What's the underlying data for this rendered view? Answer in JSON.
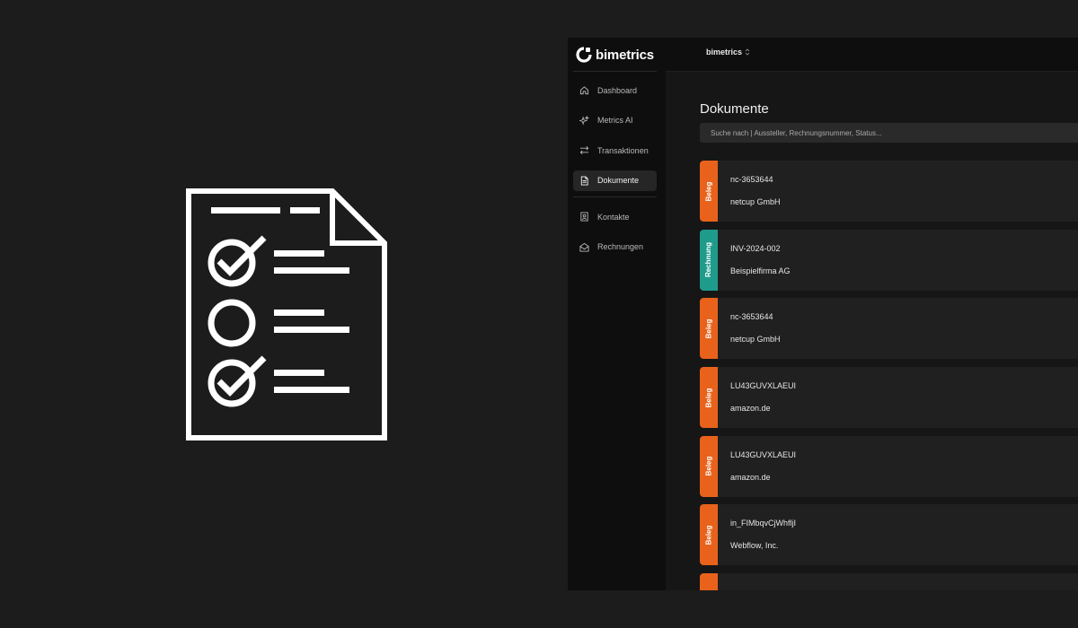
{
  "colors": {
    "background": "#1c1c1c",
    "beleg": "#e8621c",
    "rechnung": "#1f9b8c",
    "sidebar": "#0e0e0e",
    "card": "#202020"
  },
  "brand": {
    "name": "bimetrics",
    "logo_icon": "bimetrics-logo-icon"
  },
  "hero": {
    "icon": "document-checklist-icon"
  },
  "sidebar": {
    "items": [
      {
        "label": "Dashboard",
        "icon": "home-icon",
        "active": false
      },
      {
        "label": "Metrics AI",
        "icon": "sparkle-icon",
        "active": false
      },
      {
        "label": "Transaktionen",
        "icon": "arrows-exchange-icon",
        "active": false
      },
      {
        "label": "Dokumente",
        "icon": "document-icon",
        "active": true
      },
      {
        "label": "Kontakte",
        "icon": "contact-card-icon",
        "active": false
      },
      {
        "label": "Rechnungen",
        "icon": "envelope-open-icon",
        "active": false
      }
    ]
  },
  "topbar": {
    "workspace": "bimetrics",
    "workspace_icon": "selector-icon"
  },
  "main": {
    "title": "Dokumente",
    "search_placeholder": "Suche nach | Aussteller, Rechnungsnummer, Status..."
  },
  "documents": [
    {
      "type": "Beleg",
      "number": "nc-3653644",
      "issuer": "netcup GmbH"
    },
    {
      "type": "Rechnung",
      "number": "INV-2024-002",
      "issuer": "Beispielfirma AG"
    },
    {
      "type": "Beleg",
      "number": "nc-3653644",
      "issuer": "netcup GmbH"
    },
    {
      "type": "Beleg",
      "number": "LU43GUVXLAEUI",
      "issuer": "amazon.de"
    },
    {
      "type": "Beleg",
      "number": "LU43GUVXLAEUI",
      "issuer": "amazon.de"
    },
    {
      "type": "Beleg",
      "number": "in_FIMbqvCjWhfljI",
      "issuer": "Webflow, Inc."
    },
    {
      "type": "Beleg",
      "number": "",
      "issuer": ""
    }
  ]
}
